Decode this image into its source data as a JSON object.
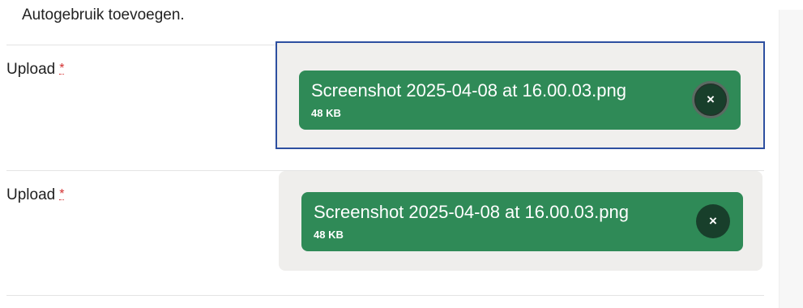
{
  "intro": {
    "text": "Autogebruik toevoegen."
  },
  "uploads": [
    {
      "label": "Upload",
      "required_marker": "*",
      "file": {
        "name": "Screenshot 2025-04-08 at 16.00.03.png",
        "size": "48 KB"
      },
      "remove_symbol": "×",
      "focused": true
    },
    {
      "label": "Upload",
      "required_marker": "*",
      "file": {
        "name": "Screenshot 2025-04-08 at 16.00.03.png",
        "size": "48 KB"
      },
      "remove_symbol": "×",
      "focused": false
    }
  ],
  "colors": {
    "chip_green": "#2f8a57",
    "remove_dark": "#183f2b",
    "focus_blue": "#2d4fa0",
    "dropzone_bg": "#efeeec",
    "required_red": "#d32f2f"
  }
}
